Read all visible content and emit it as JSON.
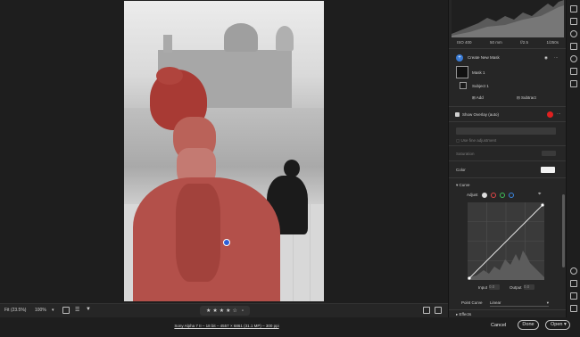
{
  "histogram": {
    "iso": "ISO 400",
    "focal": "50 mm",
    "aperture": "f/2.5",
    "shutter": "1/250s"
  },
  "masks": {
    "create_label": "Create New Mask",
    "mask_name": "Mask 1",
    "subject_name": "Subject 1",
    "add_label": "Add",
    "subtract_label": "Subtract",
    "show_overlay_label": "Show Overlay (auto)",
    "overlay_color": "#e02020"
  },
  "adjust": {
    "use_fine_label": "Use fine adjustment",
    "saturation_label": "Saturation",
    "color_label": "Color"
  },
  "curve": {
    "section_label": "Curve",
    "adjust_label": "Adjust",
    "input_label": "Input",
    "input_value": "0.0",
    "output_label": "Output",
    "output_value": "0.0",
    "point_curve_label": "Point Curve",
    "point_curve_value": "Linear",
    "effects_label": "Effects"
  },
  "canvas_bar": {
    "fit_label": "Fit (23.5%)",
    "zoom_label": "100%",
    "rating": 4,
    "stars_total": 5
  },
  "footer": {
    "file_info": "Sony Alpha 7 II – 18 bit – 4557 × 6861 (31.1 MP) – 300 ppi",
    "cancel_label": "Cancel",
    "done_label": "Done",
    "open_label": "Open"
  },
  "colors": {
    "mask_red": "#b3504a",
    "accent_blue": "#3a7bd5"
  }
}
